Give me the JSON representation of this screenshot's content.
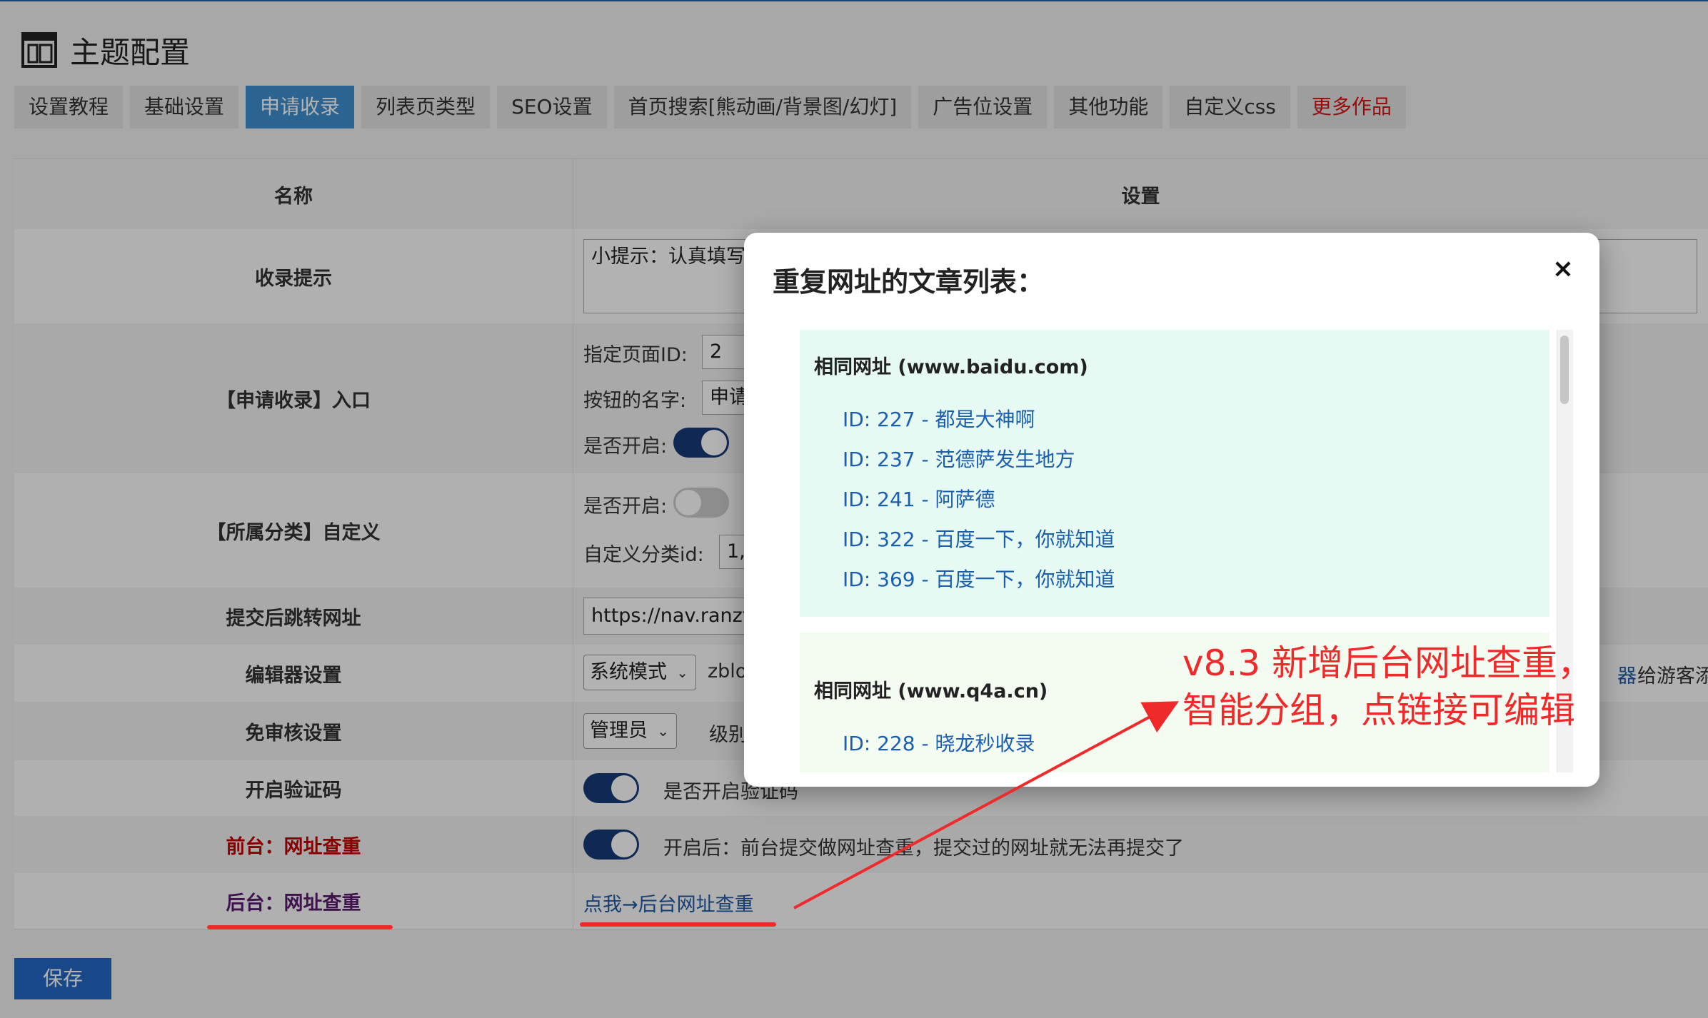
{
  "header": {
    "title": "主题配置",
    "icon": "layout-icon"
  },
  "tabs": [
    {
      "label": "设置教程"
    },
    {
      "label": "基础设置"
    },
    {
      "label": "申请收录"
    },
    {
      "label": "列表页类型"
    },
    {
      "label": "SEO设置"
    },
    {
      "label": "首页搜索[熊动画/背景图/幻灯]"
    },
    {
      "label": "广告位设置"
    },
    {
      "label": "其他功能"
    },
    {
      "label": "自定义css"
    },
    {
      "label": "更多作品"
    }
  ],
  "table": {
    "col_name": "名称",
    "col_setting": "设置",
    "rows": {
      "tip": {
        "name": "收录提示",
        "text": "小提示：认真填写"
      },
      "entry": {
        "name": "【申请收录】入口",
        "page_id_label": "指定页面ID:",
        "page_id_value": "2",
        "button_label": "按钮的名字:",
        "button_value": "申请",
        "enable_label": "是否开启:"
      },
      "category": {
        "name": "【所属分类】自定义",
        "enable_label": "是否开启:",
        "cat_label": "自定义分类id:",
        "cat_value": "1,"
      },
      "redirect": {
        "name": "提交后跳转网址",
        "value": "https://nav.ranzt"
      },
      "editor": {
        "name": "编辑器设置",
        "select": "系统模式",
        "text": "zblo",
        "right_link": "器",
        "right_text": "给游客添加"
      },
      "audit": {
        "name": "免审核设置",
        "select": "管理员",
        "text": "级别"
      },
      "captcha": {
        "name": "开启验证码",
        "text": "是否开启验证码"
      },
      "front_dup": {
        "name": "前台：网址查重",
        "text": "开启后：前台提交做网址查重，提交过的网址就无法再提交了"
      },
      "back_dup": {
        "name": "后台：网址查重",
        "link": "点我→后台网址查重"
      }
    }
  },
  "save_label": "保存",
  "modal": {
    "title": "重复网址的文章列表：",
    "close": "×",
    "groups": [
      {
        "title": "相同网址 (www.baidu.com)",
        "items": [
          "ID: 227 - 都是大神啊",
          "ID: 237 - 范德萨发生地方",
          "ID: 241 - 阿萨德",
          "ID: 322 - 百度一下，你就知道",
          "ID: 369 - 百度一下，你就知道"
        ]
      },
      {
        "title": "相同网址 (www.q4a.cn)",
        "items": [
          "ID: 228 - 晓龙秒收录"
        ]
      }
    ]
  },
  "annotation": {
    "line1": "v8.3 新增后台网址查重，",
    "line2": "智能分组，点链接可编辑"
  },
  "colors": {
    "accent": "#3e8ed0",
    "toggle_on": "#173c79",
    "annotation_red": "#ee2a2a",
    "link_blue": "#1a5fae",
    "front_label_red": "#c00000",
    "back_label_purple": "#5a1a6e"
  }
}
